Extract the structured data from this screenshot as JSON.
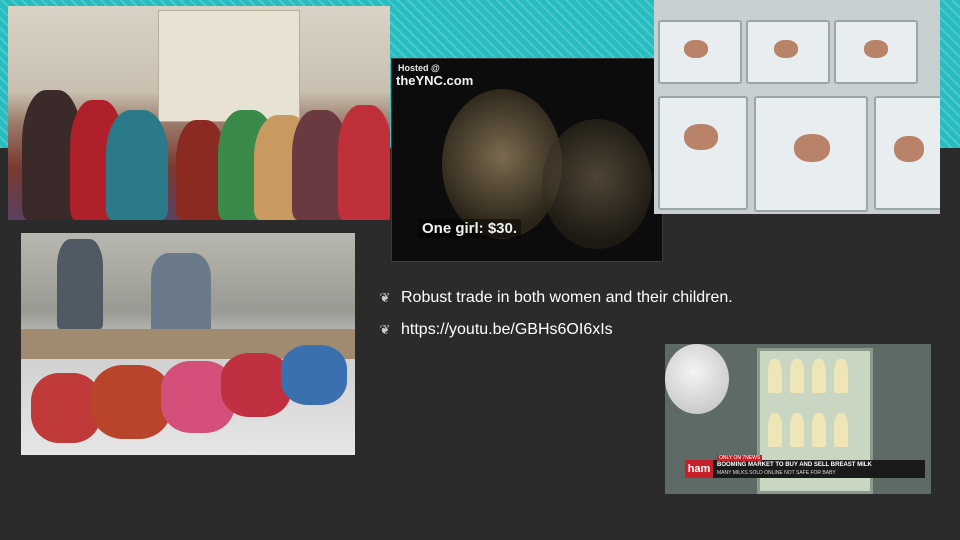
{
  "slide": {
    "bullets": [
      {
        "icon": "leaf-icon",
        "text": "Robust trade in both women and their children."
      },
      {
        "icon": "leaf-icon",
        "text": "https://youtu.be/GBHs6OI6xIs"
      }
    ]
  },
  "photos": {
    "video_still": {
      "hosted": "Hosted @",
      "site": "theYNC.com",
      "caption": "One girl: $30."
    },
    "news_still": {
      "only_on": "ONLY ON 7NEWS",
      "headline": "BOOMING MARKET TO BUY AND SELL BREAST MILK",
      "subline": "MANY MILKS SOLD ONLINE NOT SAFE FOR BABY",
      "logo": "ham"
    }
  },
  "colors": {
    "background": "#2b2b2b",
    "accent_band": "#26bcc0",
    "text": "#ffffff"
  }
}
